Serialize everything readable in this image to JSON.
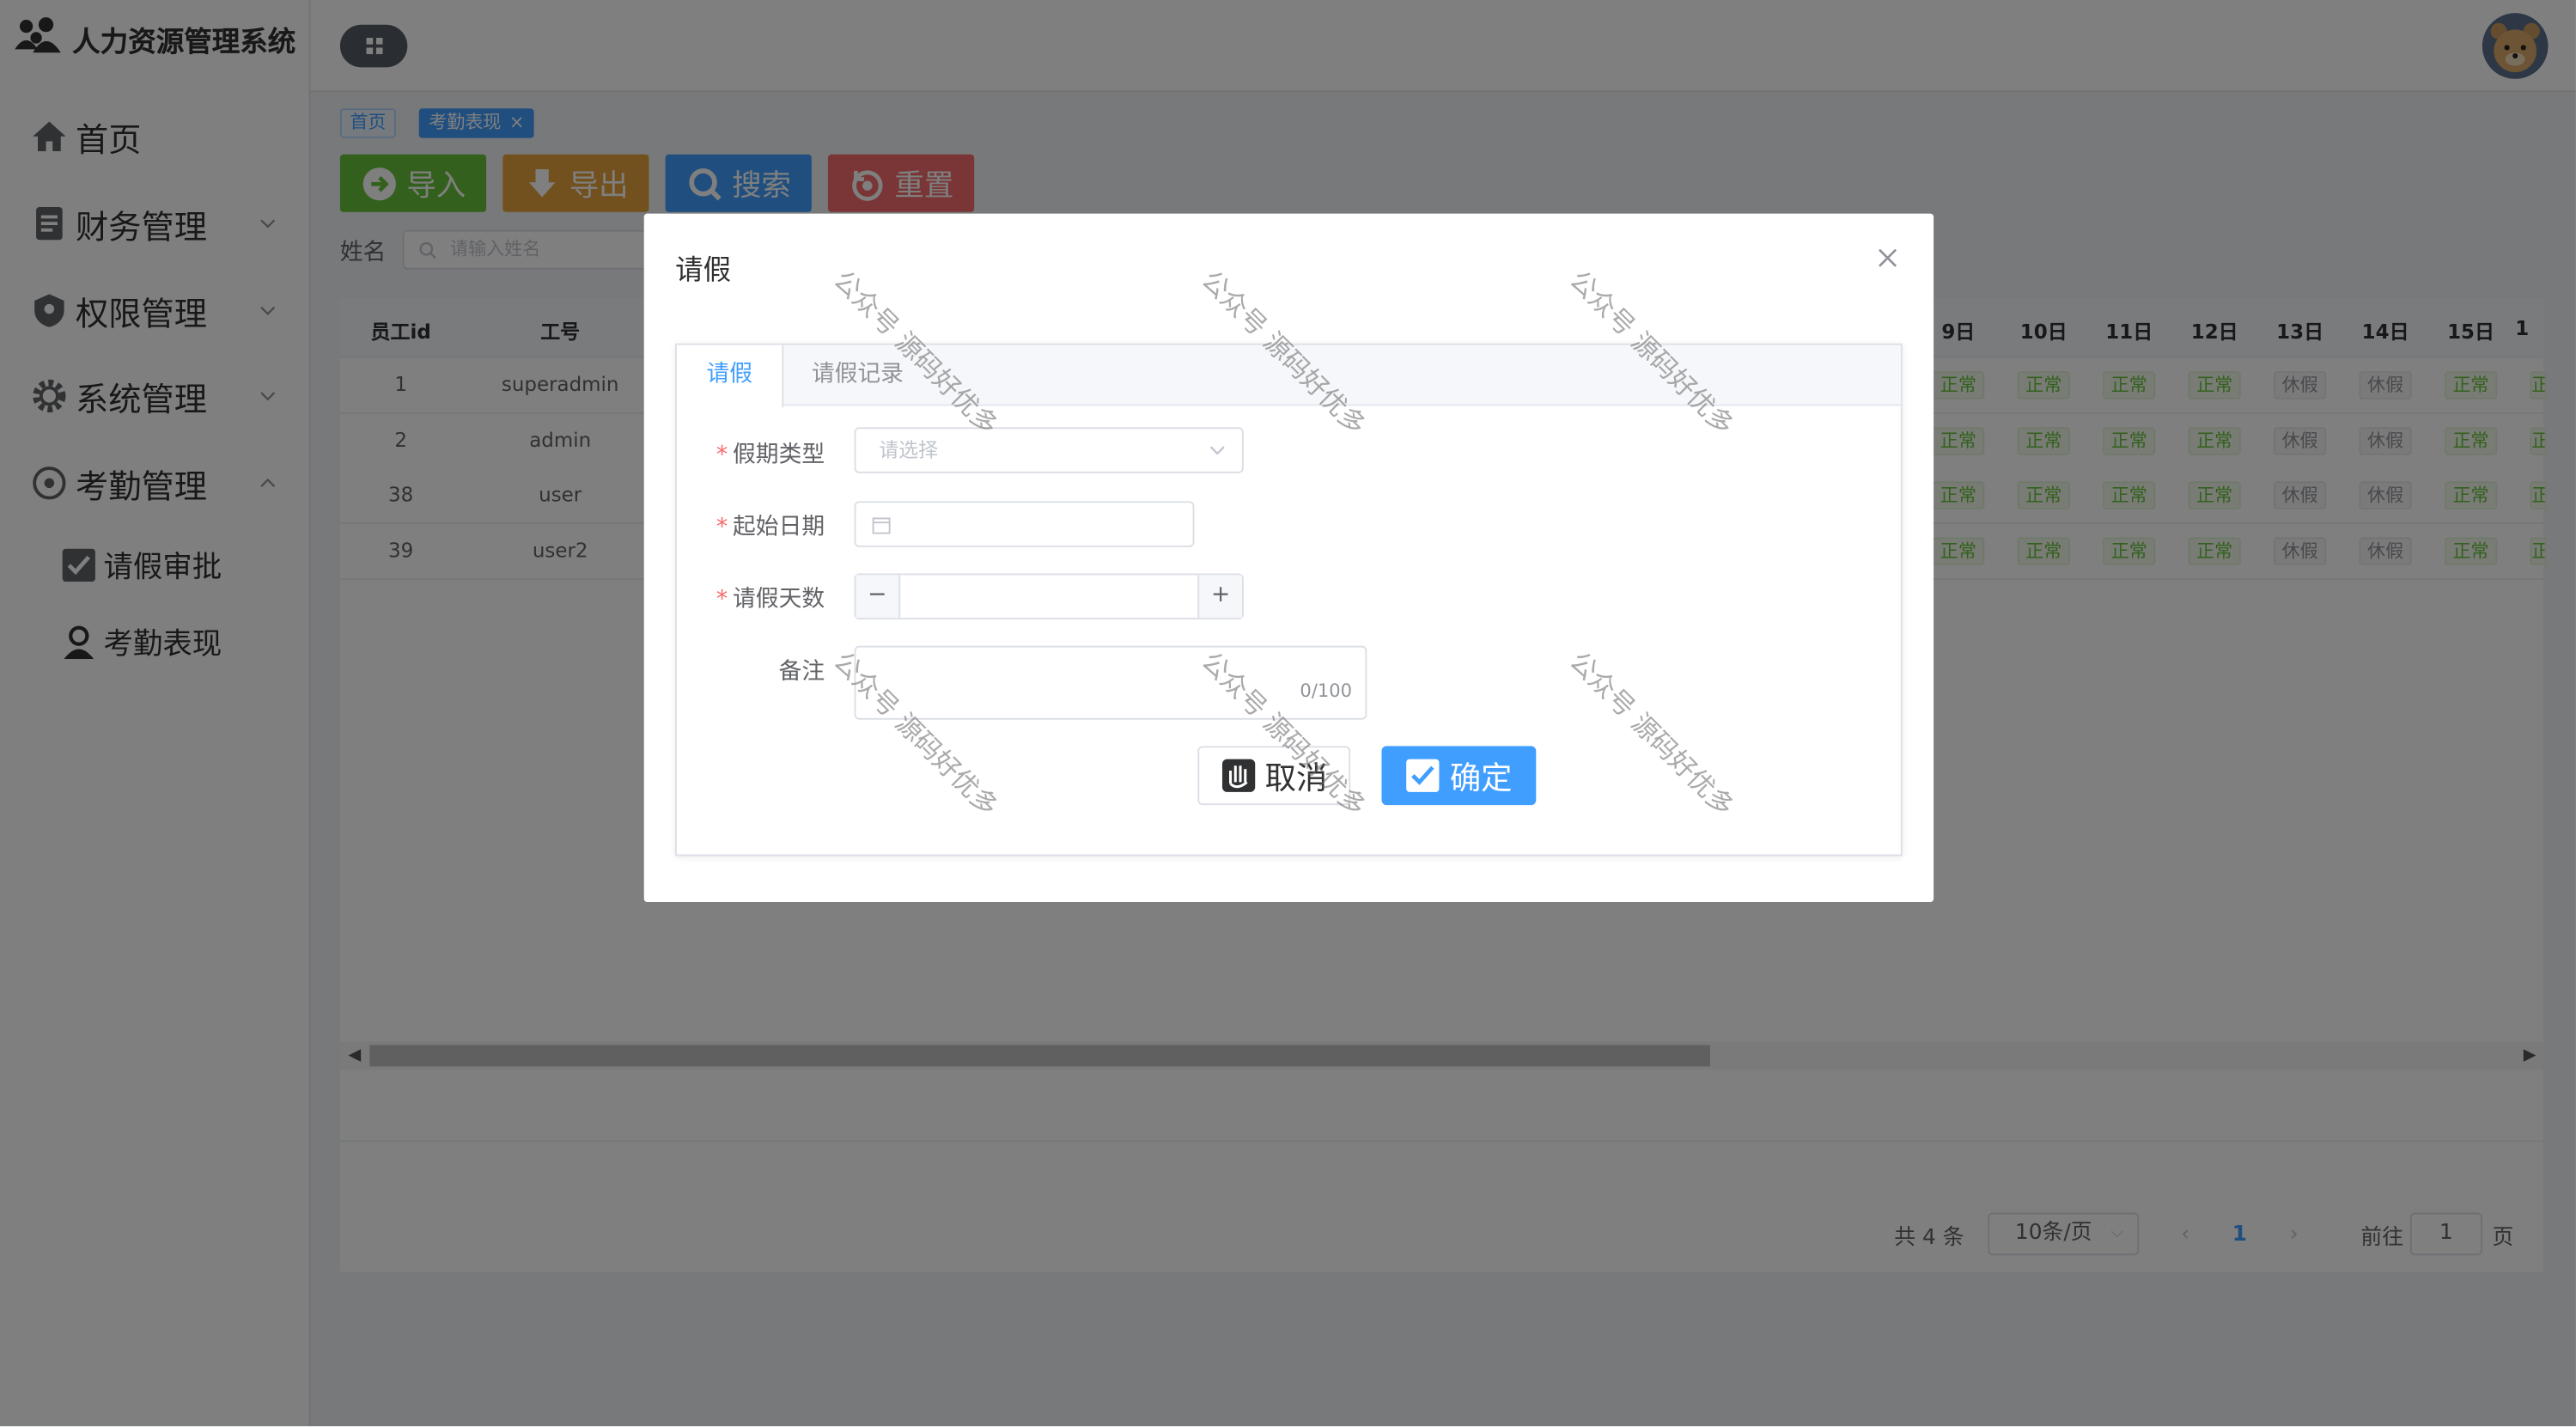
{
  "app": {
    "title": "人力资源管理系统"
  },
  "sidebar": {
    "items": [
      {
        "label": "首页",
        "icon": "home-icon"
      },
      {
        "label": "财务管理",
        "icon": "document-icon"
      },
      {
        "label": "权限管理",
        "icon": "shield-icon"
      },
      {
        "label": "系统管理",
        "icon": "gear-icon"
      },
      {
        "label": "考勤管理",
        "icon": "attendance-icon"
      }
    ],
    "sub_items": [
      {
        "label": "请假审批",
        "icon": "check-square-icon"
      },
      {
        "label": "考勤表现",
        "icon": "user-icon"
      }
    ]
  },
  "tags": [
    {
      "label": "首页"
    },
    {
      "label": "考勤表现",
      "close": "×"
    }
  ],
  "toolbar": {
    "import_label": "导入",
    "export_label": "导出",
    "search_label": "搜索",
    "reset_label": "重置",
    "name_label": "姓名",
    "name_placeholder": "请输入姓名"
  },
  "table": {
    "left_headers": [
      "员工id",
      "工号"
    ],
    "day_headers": [
      "9日",
      "10日",
      "11日",
      "12日",
      "13日",
      "14日",
      "15日",
      "1"
    ],
    "rows": [
      {
        "id": "1",
        "no": "superadmin",
        "days": [
          "正常",
          "正常",
          "正常",
          "正常",
          "休假",
          "休假",
          "正常",
          "正"
        ]
      },
      {
        "id": "2",
        "no": "admin",
        "days": [
          "正常",
          "正常",
          "正常",
          "正常",
          "休假",
          "休假",
          "正常",
          "正"
        ]
      },
      {
        "id": "38",
        "no": "user",
        "days": [
          "正常",
          "正常",
          "正常",
          "正常",
          "休假",
          "休假",
          "正常",
          "正"
        ]
      },
      {
        "id": "39",
        "no": "user2",
        "days": [
          "正常",
          "正常",
          "正常",
          "正常",
          "休假",
          "休假",
          "正常",
          "正"
        ]
      }
    ]
  },
  "pagination": {
    "total": "共 4 条",
    "page_size": "10条/页",
    "prev": "‹",
    "current": "1",
    "next": "›",
    "goto_label": "前往",
    "goto_value": "1",
    "page_suffix": "页"
  },
  "dialog": {
    "title": "请假",
    "tabs": [
      "请假",
      "请假记录"
    ],
    "fields": {
      "leave_type_label": "假期类型",
      "leave_type_placeholder": "请选择",
      "start_date_label": "起始日期",
      "days_label": "请假天数",
      "days_minus": "−",
      "days_plus": "+",
      "remark_label": "备注",
      "remark_counter": "0/100",
      "required_mark": "*"
    },
    "cancel_label": "取消",
    "confirm_label": "确定"
  },
  "watermark": "公众号 源码好优多",
  "colors": {
    "primary": "#409eff",
    "success": "#67c23a",
    "warning": "#e6a23c",
    "danger": "#f56c6c"
  }
}
